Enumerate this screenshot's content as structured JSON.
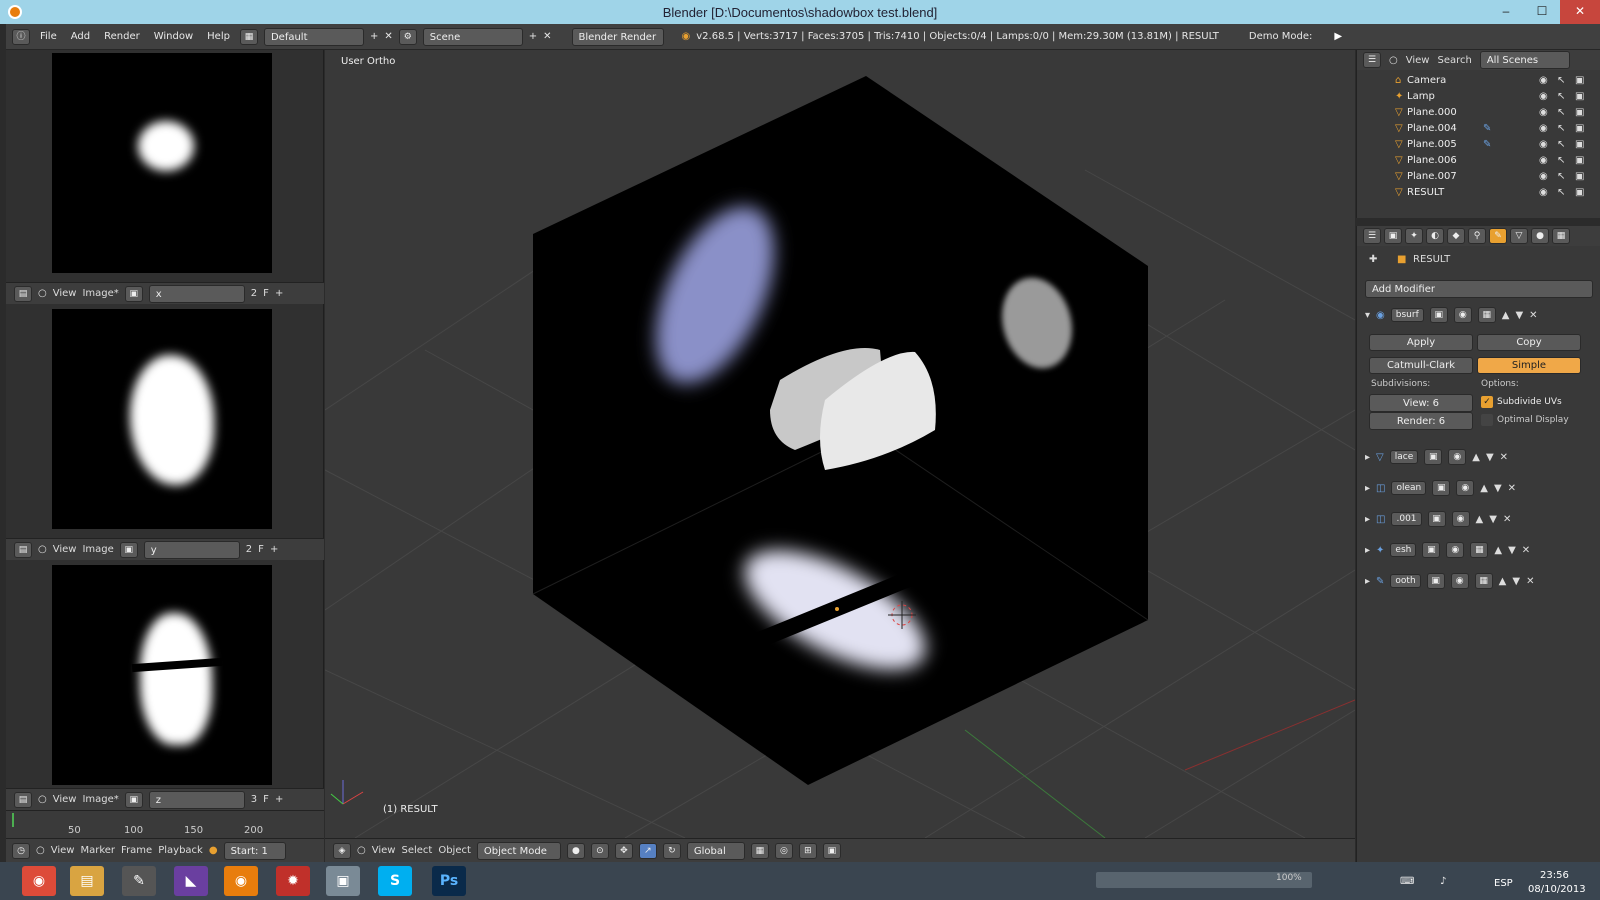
{
  "window": {
    "title": "Blender [D:\\Documentos\\shadowbox test.blend]",
    "minimize": "–",
    "maximize": "☐",
    "close": "✕"
  },
  "header": {
    "menus": [
      "File",
      "Add",
      "Render",
      "Window",
      "Help"
    ],
    "layout": "Default",
    "scene": "Scene",
    "engine": "Blender Render",
    "stats": "v2.68.5 | Verts:3717 | Faces:3705 | Tris:7410 | Objects:0/4 | Lamps:0/0 | Mem:29.30M (13.81M) | RESULT",
    "demo_mode": "Demo Mode:"
  },
  "image_editors": [
    {
      "view": "View",
      "image": "Image*",
      "name": "x",
      "users": "2",
      "fake": "F"
    },
    {
      "view": "View",
      "image": "Image",
      "name": "y",
      "users": "2",
      "fake": "F"
    },
    {
      "view": "View",
      "image": "Image*",
      "name": "z",
      "users": "3",
      "fake": "F"
    }
  ],
  "timeline": {
    "ticks": [
      "50",
      "100",
      "150",
      "200"
    ],
    "menus": [
      "View",
      "Marker",
      "Frame",
      "Playback"
    ],
    "start": "Start: 1"
  },
  "viewport": {
    "view_label": "User Ortho",
    "object_label": "(1) RESULT",
    "menus": [
      "View",
      "Select",
      "Object"
    ],
    "mode": "Object Mode",
    "orientation": "Global"
  },
  "outliner": {
    "menus": [
      "View",
      "Search"
    ],
    "filter": "All Scenes",
    "items": [
      {
        "name": "Camera"
      },
      {
        "name": "Lamp"
      },
      {
        "name": "Plane.000"
      },
      {
        "name": "Plane.004"
      },
      {
        "name": "Plane.005"
      },
      {
        "name": "Plane.006"
      },
      {
        "name": "Plane.007"
      },
      {
        "name": "RESULT"
      }
    ]
  },
  "properties": {
    "object": "RESULT",
    "add_modifier": "Add Modifier",
    "subsurf": {
      "name": "bsurf",
      "apply": "Apply",
      "copy": "Copy",
      "catmull": "Catmull-Clark",
      "simple": "Simple",
      "subdivisions": "Subdivisions:",
      "options": "Options:",
      "view": "View: 6",
      "render": "Render: 6",
      "subdivide_uvs": "Subdivide UVs",
      "optimal": "Optimal Display"
    },
    "modifiers": [
      "lace",
      "olean",
      ".001",
      "esh",
      "ooth"
    ]
  },
  "taskbar": {
    "zoom": "100%",
    "lang": "ESP",
    "time": "23:56",
    "date": "08/10/2013"
  },
  "colors": {
    "accent": "#e8a030",
    "titlebar": "#9fd4e8",
    "selected": "#f0a848"
  }
}
